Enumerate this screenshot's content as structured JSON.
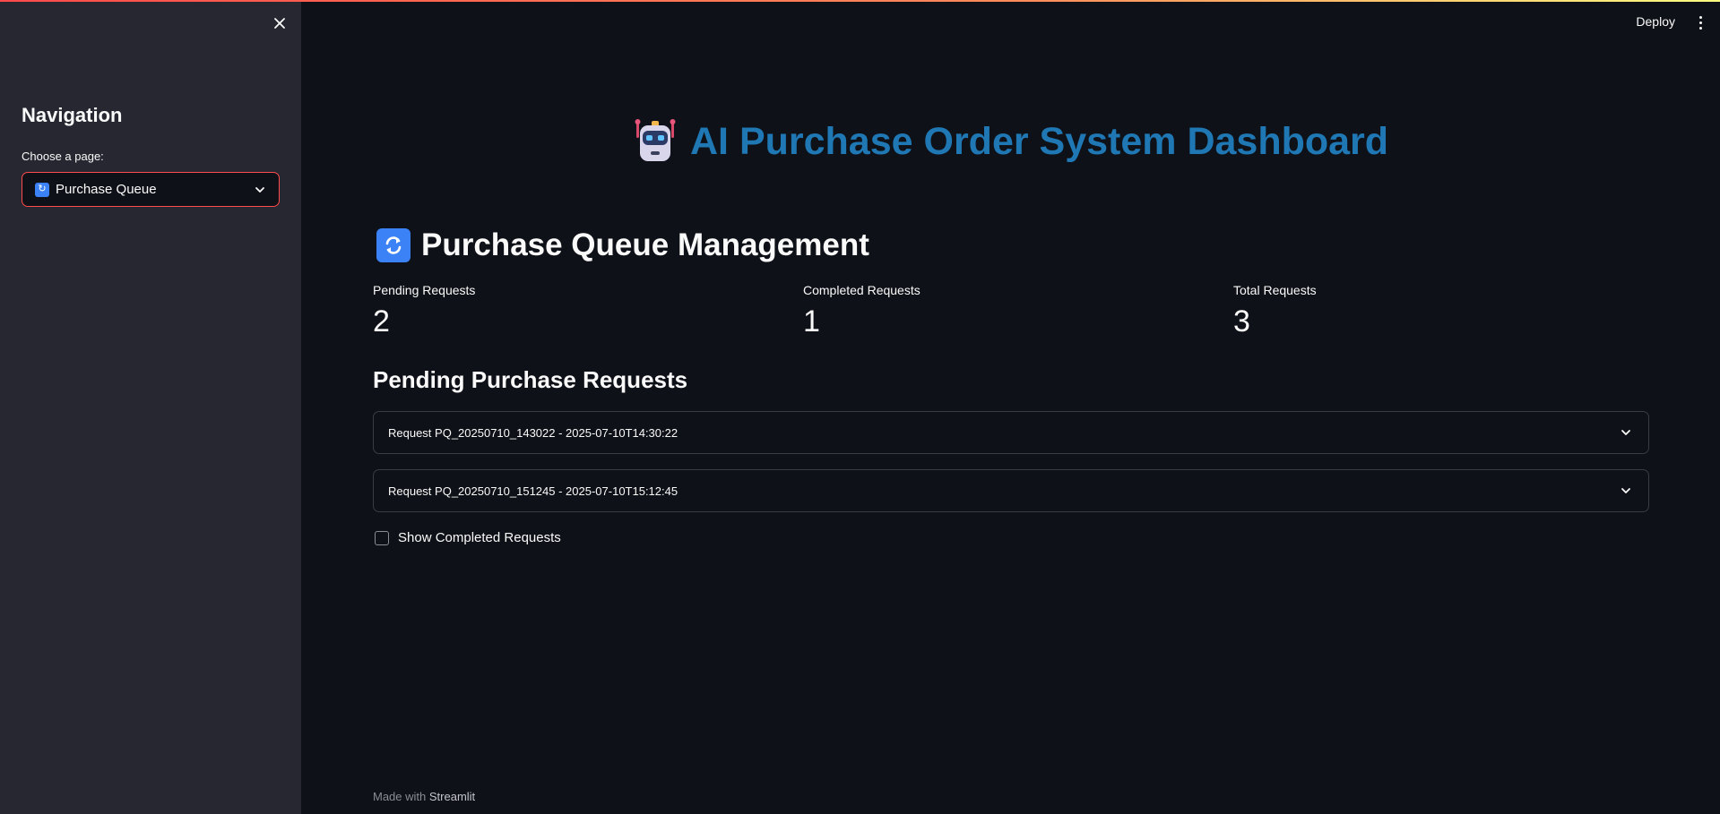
{
  "sidebar": {
    "nav_title": "Navigation",
    "select_label": "Choose a page:",
    "selected_page": "Purchase Queue",
    "selected_icon": "sync-icon"
  },
  "header": {
    "deploy_label": "Deploy",
    "menu_icon": "kebab-menu-icon"
  },
  "main": {
    "app_icon": "robot-icon",
    "app_title": "AI Purchase Order System Dashboard",
    "section_icon": "sync-icon",
    "section_title": "Purchase Queue Management",
    "metrics": [
      {
        "label": "Pending Requests",
        "value": "2"
      },
      {
        "label": "Completed Requests",
        "value": "1"
      },
      {
        "label": "Total Requests",
        "value": "3"
      }
    ],
    "pending_title": "Pending Purchase Requests",
    "requests": [
      {
        "label": "Request PQ_20250710_143022 - 2025-07-10T14:30:22"
      },
      {
        "label": "Request PQ_20250710_151245 - 2025-07-10T15:12:45"
      }
    ],
    "show_completed_label": "Show Completed Requests",
    "show_completed_checked": false
  },
  "footer": {
    "made_with": "Made with",
    "brand": "Streamlit"
  },
  "colors": {
    "background": "#0e1117",
    "sidebar": "#262730",
    "accent": "#ff4b4b",
    "title_blue": "#1f77b4"
  }
}
